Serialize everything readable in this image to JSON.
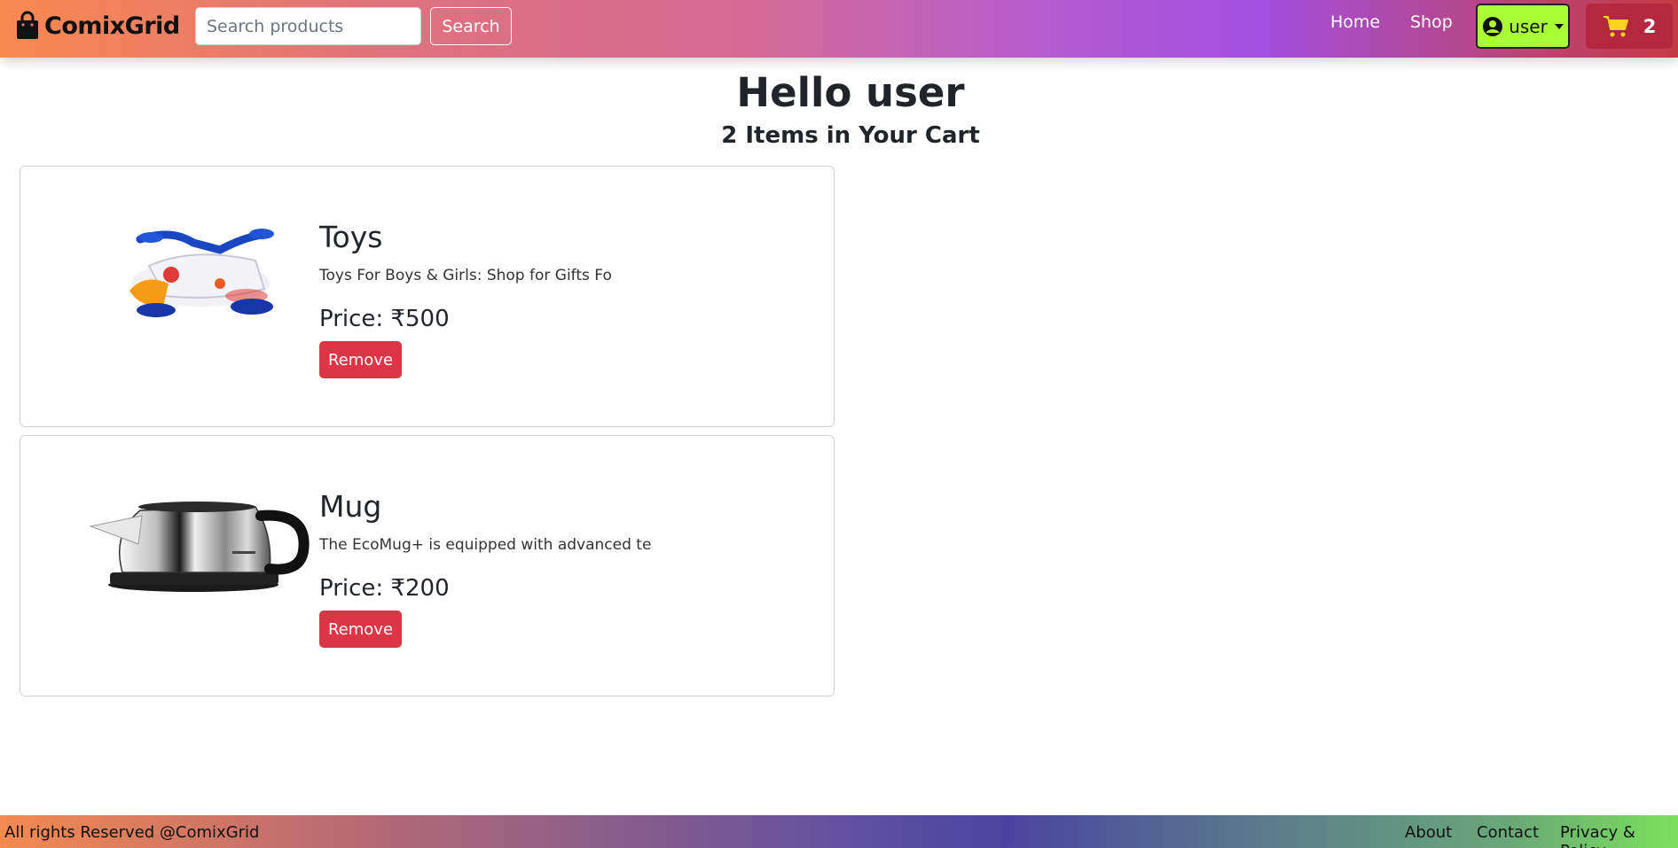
{
  "navbar": {
    "brand": "ComixGrid",
    "search_placeholder": "Search products",
    "search_button": "Search",
    "links": [
      "Home",
      "Shop"
    ],
    "user_label": "user",
    "cart_count": "2",
    "user_button_color": "#a8ff37",
    "cart_button_color": "#b3283f"
  },
  "main": {
    "title": "Hello user",
    "subtitle": "2 Items in Your Cart",
    "items": [
      {
        "name": "Toys",
        "description": "Toys For Boys & Girls: Shop for Gifts Fo",
        "price": "Price: ₹500",
        "remove_label": "Remove",
        "image": "toy-scooter-image"
      },
      {
        "name": "Mug",
        "description": "The EcoMug+ is equipped with advanced te",
        "price": "Price: ₹200",
        "remove_label": "Remove",
        "image": "electric-kettle-image"
      }
    ]
  },
  "footer": {
    "copyright": "All rights Reserved @ComixGrid",
    "links": [
      "About",
      "Contact",
      "Privacy & Policy"
    ]
  },
  "colors": {
    "remove_button": "#dc3545"
  }
}
